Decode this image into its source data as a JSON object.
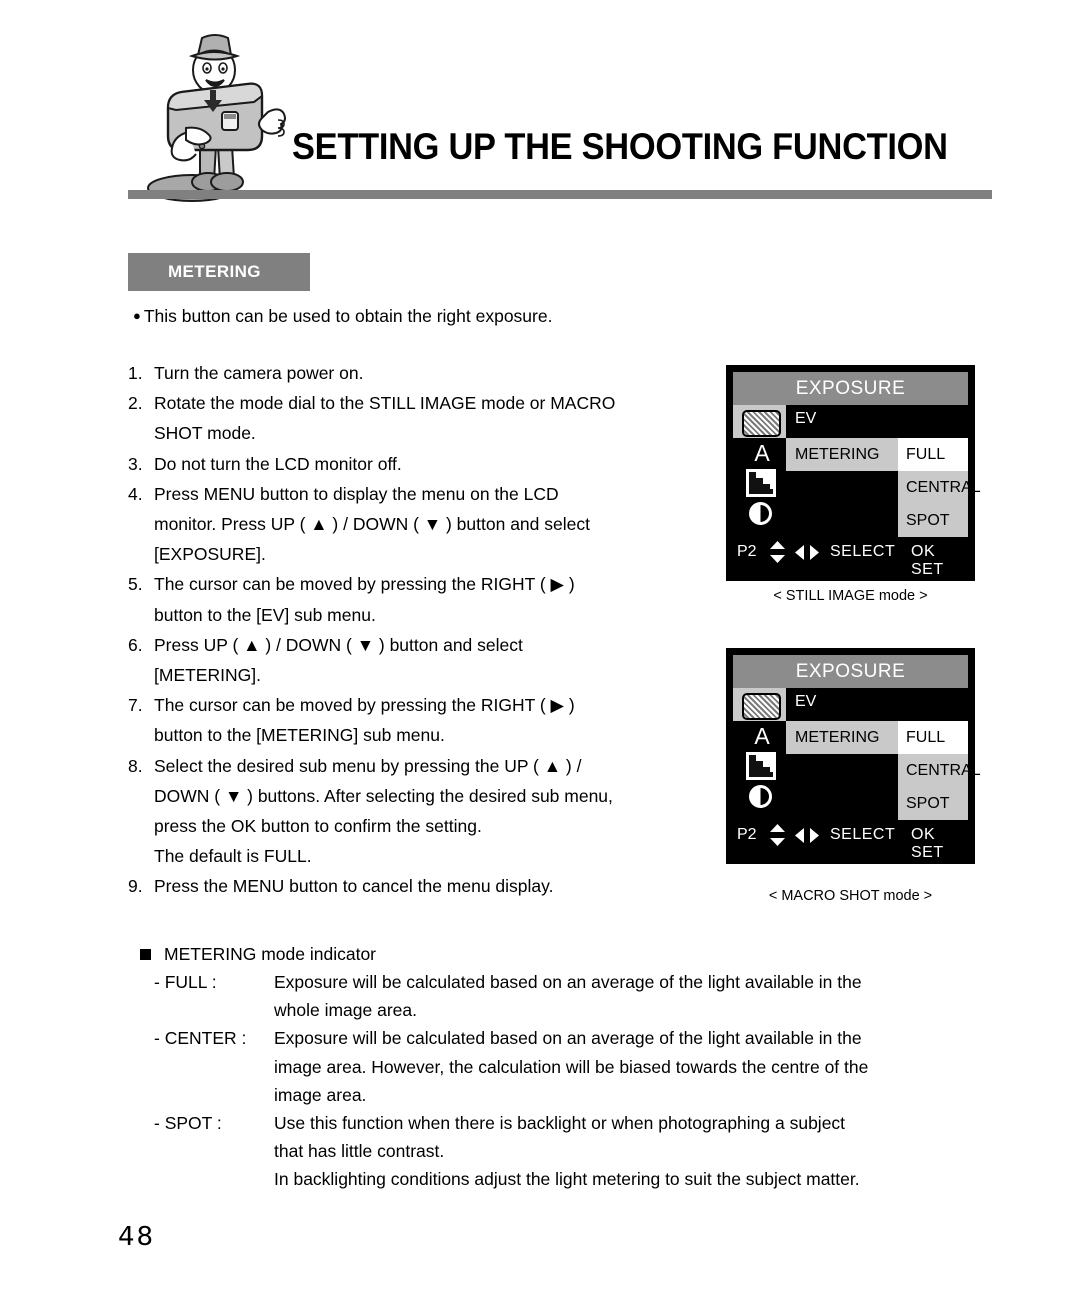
{
  "header": {
    "title": "SETTING UP THE SHOOTING FUNCTION",
    "mascot_icon": "camera-mascot-character"
  },
  "section": {
    "badge_label": "METERING",
    "intro": "This button can be used to obtain the right exposure."
  },
  "steps": [
    {
      "num": "1.",
      "lines": [
        "Turn the camera power on."
      ]
    },
    {
      "num": "2.",
      "lines": [
        "Rotate the mode dial to the STILL IMAGE mode or MACRO",
        "SHOT mode."
      ]
    },
    {
      "num": "3.",
      "lines": [
        "Do not turn the LCD monitor off."
      ]
    },
    {
      "num": "4.",
      "lines": [
        "Press MENU button to display the menu on the LCD",
        "monitor. Press UP ( ▲ ) / DOWN ( ▼ ) button and select",
        "[EXPOSURE]."
      ]
    },
    {
      "num": "5.",
      "lines": [
        "The cursor can be moved by pressing the RIGHT ( ▶ )",
        "button to the [EV] sub menu."
      ]
    },
    {
      "num": "6.",
      "lines": [
        "Press UP ( ▲ ) / DOWN ( ▼ ) button and select",
        "[METERING]."
      ]
    },
    {
      "num": "7.",
      "lines": [
        "The cursor can be moved by pressing the RIGHT ( ▶ )",
        "button to the [METERING] sub menu."
      ]
    },
    {
      "num": "8.",
      "lines": [
        "Select the desired sub menu by pressing the UP ( ▲ ) /",
        "DOWN ( ▼ ) buttons. After selecting the desired sub menu,",
        "press the OK button to confirm the setting.",
        "The default is FULL."
      ]
    },
    {
      "num": "9.",
      "lines": [
        "Press the MENU button to cancel the menu display."
      ]
    }
  ],
  "lcd_screens": [
    {
      "title": "EXPOSURE",
      "ev_label": "EV",
      "ev_icon": "exposure-hatched-rect-icon",
      "icons": [
        "aperture-a-icon",
        "histogram-icon",
        "contrast-half-circle-icon"
      ],
      "menu_item": "METERING",
      "submenu": [
        {
          "label": "FULL",
          "selected": true
        },
        {
          "label": "CENTRAL",
          "selected": false
        },
        {
          "label": "SPOT",
          "selected": false
        }
      ],
      "status": {
        "page": "P2",
        "updown_icon": "up-down-arrows-icon",
        "leftright_icon": "left-right-arrows-icon",
        "select_label": "SELECT",
        "ok_label": "OK SET"
      },
      "caption": "< STILL IMAGE mode >"
    },
    {
      "title": "EXPOSURE",
      "ev_label": "EV",
      "ev_icon": "exposure-hatched-rect-icon",
      "icons": [
        "aperture-a-icon",
        "histogram-icon",
        "contrast-half-circle-icon"
      ],
      "menu_item": "METERING",
      "submenu": [
        {
          "label": "FULL",
          "selected": true
        },
        {
          "label": "CENTRAL",
          "selected": false
        },
        {
          "label": "SPOT",
          "selected": false
        }
      ],
      "status": {
        "page": "P2",
        "updown_icon": "up-down-arrows-icon",
        "leftright_icon": "left-right-arrows-icon",
        "select_label": "SELECT",
        "ok_label": "OK SET"
      },
      "caption": "< MACRO SHOT mode >"
    }
  ],
  "indicator": {
    "heading": "METERING mode indicator",
    "entries": [
      {
        "term": "- FULL :",
        "lines": [
          "Exposure will be calculated based on an average of the light available in the",
          "whole image area."
        ]
      },
      {
        "term": "- CENTER :",
        "lines": [
          "Exposure will be calculated based on an average of the light available in the",
          "image area. However, the calculation will be biased towards the centre of the",
          "image area."
        ]
      },
      {
        "term": "- SPOT :",
        "lines": [
          "Use this function when there is backlight or when photographing a subject",
          "that has little contrast.",
          "In backlighting conditions adjust the light metering to suit the subject matter."
        ]
      }
    ]
  },
  "footer": {
    "page_number": "48"
  },
  "colors": {
    "rule_gray": "#808080",
    "badge_gray": "#808080",
    "lcd_black": "#000000",
    "lcd_title_gray": "#8c8c8c",
    "lcd_highlight_gray": "#c9c9c9",
    "lcd_selected_white": "#ffffff"
  }
}
